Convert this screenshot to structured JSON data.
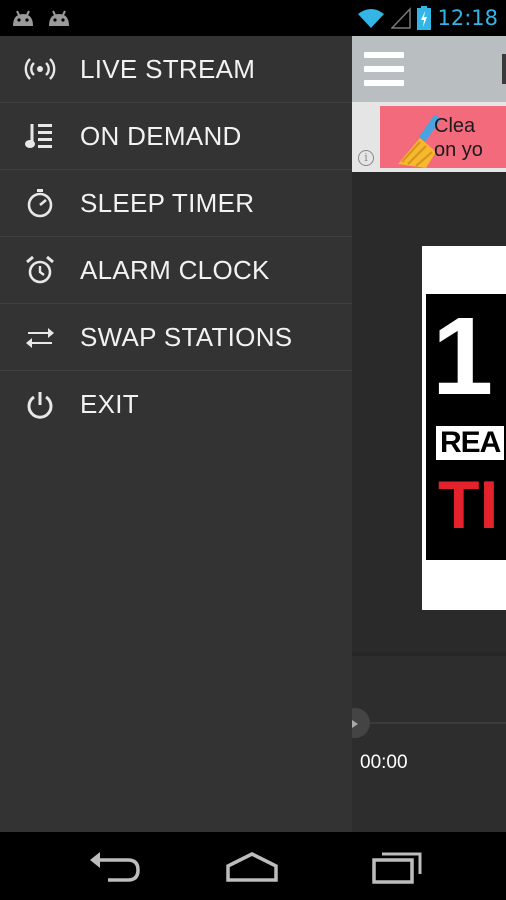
{
  "status_bar": {
    "time": "12:18",
    "notifications": [
      "android-icon",
      "android-icon"
    ],
    "icons": [
      "wifi-icon",
      "signal-icon",
      "battery-charging-icon"
    ]
  },
  "drawer": {
    "items": [
      {
        "label": "LIVE STREAM",
        "icon": "broadcast-icon"
      },
      {
        "label": "ON DEMAND",
        "icon": "playlist-icon"
      },
      {
        "label": "SLEEP TIMER",
        "icon": "stopwatch-icon"
      },
      {
        "label": "ALARM CLOCK",
        "icon": "alarm-clock-icon"
      },
      {
        "label": "SWAP STATIONS",
        "icon": "swap-icon"
      },
      {
        "label": "EXIT",
        "icon": "power-icon"
      }
    ]
  },
  "main": {
    "ad_text": "Clea\non yo",
    "ad_info": "i",
    "artwork": {
      "line1": "1",
      "line2": "REA",
      "line3": "TI"
    },
    "player_time": "00:00"
  },
  "colors": {
    "drawer_bg": "#333333",
    "app_bar": "#b9bfc1",
    "clock": "#33b5e5",
    "ad_banner": "#f36a7d"
  }
}
